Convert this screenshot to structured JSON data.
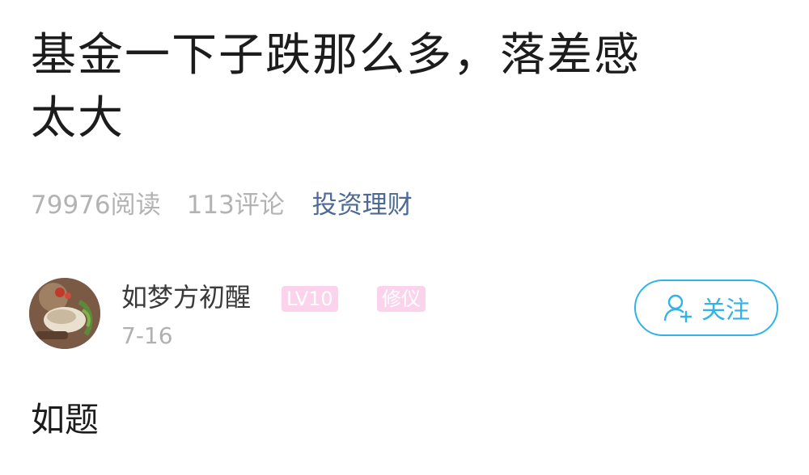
{
  "post": {
    "title_line1": "基金一下子跌那么多，落差感",
    "title_line2": "太大",
    "body": "如题"
  },
  "meta": {
    "reads": "79976阅读",
    "comments": "113评论",
    "category": "投资理财"
  },
  "author": {
    "name": "如梦方初醒",
    "level_badge": "LV10",
    "title_badge": "修仪",
    "date": "7-16"
  },
  "follow_button": {
    "label": "关注",
    "icon": "add-user-icon"
  },
  "colors": {
    "accent": "#2fb3e8",
    "category_link": "#4d6a96",
    "badge_bg": "#fbd3ec",
    "muted_text": "#b3b3b3"
  }
}
